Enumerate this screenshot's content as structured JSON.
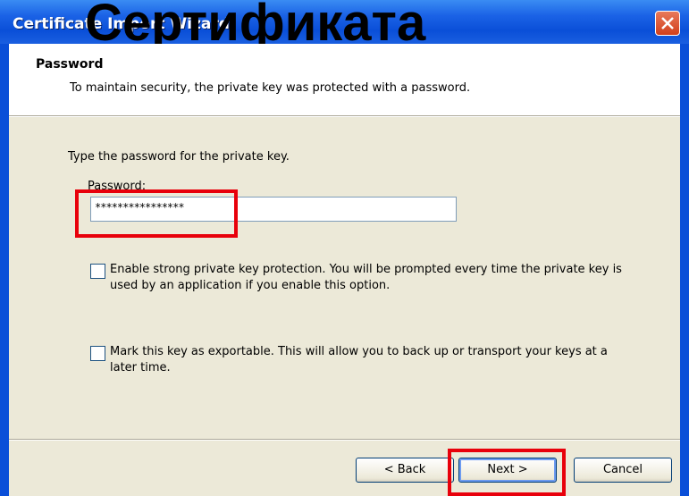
{
  "window": {
    "title": "Certificate Import Wizard",
    "overlay_title": "Сертификата"
  },
  "header": {
    "title": "Password",
    "description": "To maintain security, the private key was protected with a password."
  },
  "body": {
    "instruction": "Type the password for the private key.",
    "password_label": "Password:",
    "password_value": "****************",
    "strong_protection": {
      "checked": false,
      "text": "Enable strong private key protection. You will be prompted every time the private key is used by an application if you enable this option."
    },
    "exportable": {
      "checked": false,
      "text": "Mark this key as exportable. This will allow you to back up or transport your keys at a later time."
    }
  },
  "buttons": {
    "back": "< Back",
    "next": "Next >",
    "cancel": "Cancel"
  },
  "colors": {
    "highlight": "#e8000b",
    "titlebar": "#0a4fd8",
    "dialog_bg": "#ece9d8"
  }
}
